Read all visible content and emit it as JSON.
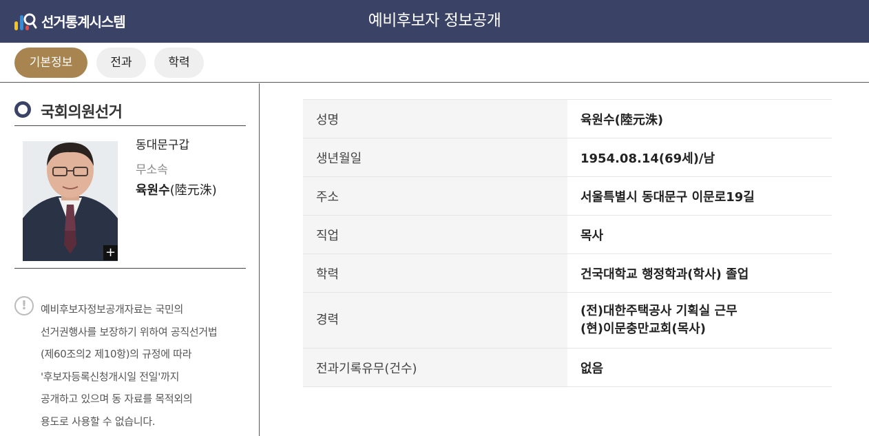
{
  "header": {
    "logo_text": "선거통계시스템",
    "title": "예비후보자 정보공개",
    "bg_color": "#3a4266"
  },
  "tabs": [
    {
      "label": "기본정보",
      "active": true
    },
    {
      "label": "전과",
      "active": false
    },
    {
      "label": "학력",
      "active": false
    }
  ],
  "accent_color": "#a88550",
  "candidate": {
    "election": "국회의원선거",
    "district": "동대문구갑",
    "party": "무소속",
    "name": "육원수",
    "name_hanja": "(陸元洙)",
    "photo_icon": "candidate-photo",
    "expand_icon": "+"
  },
  "notice": {
    "icon": "!",
    "lines": [
      "예비후보자정보공개자료는 국민의",
      "선거권행사를 보장하기 위하여 공직선거법",
      "(제60조의2 제10항)의 규정에 따라",
      "'후보자등록신청개시일 전일'까지",
      "공개하고 있으며 동 자료를 목적외의",
      "용도로 사용할 수 없습니다."
    ]
  },
  "info": [
    {
      "label": "성명",
      "value": "육원수(陸元洙)"
    },
    {
      "label": "생년월일",
      "value": "1954.08.14(69세)/남"
    },
    {
      "label": "주소",
      "value": "서울특별시 동대문구 이문로19길"
    },
    {
      "label": "직업",
      "value": "목사"
    },
    {
      "label": "학력",
      "value": "건국대학교 행정학과(학사) 졸업"
    },
    {
      "label": "경력",
      "value_lines": [
        "(전)대한주택공사 기획실 근무",
        "(현)이문충만교회(목사)"
      ]
    },
    {
      "label": "전과기록유무(건수)",
      "value": "없음"
    }
  ]
}
